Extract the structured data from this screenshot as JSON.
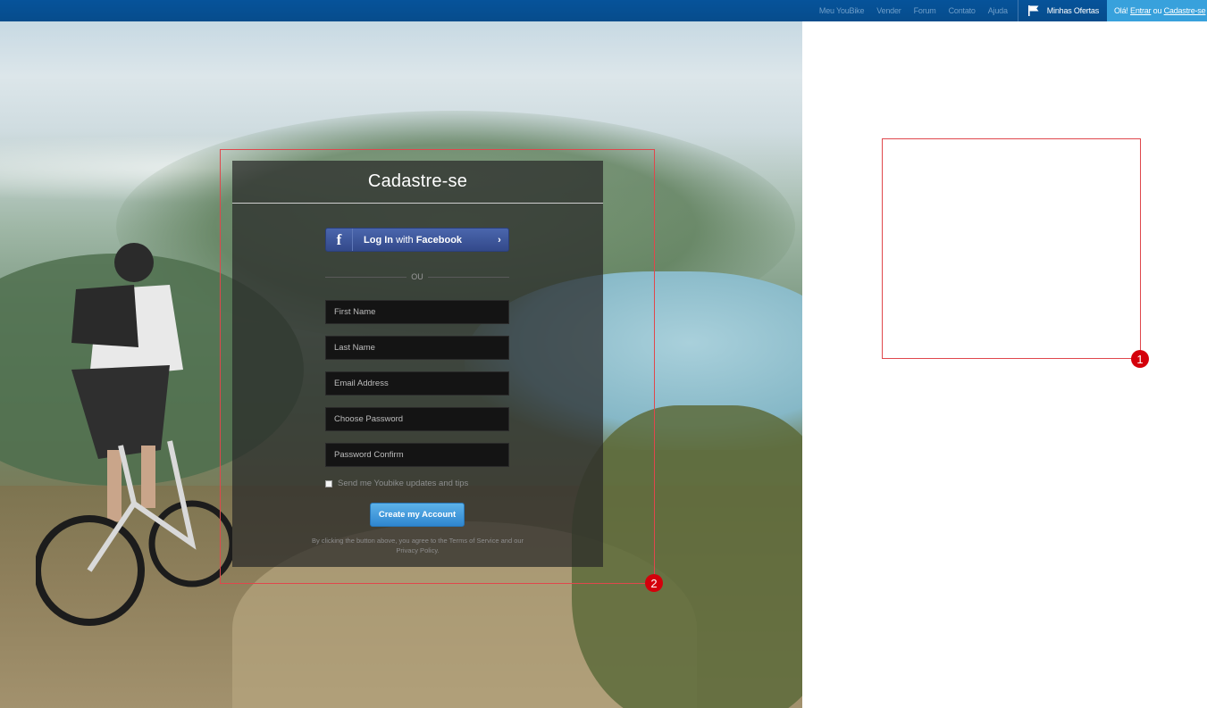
{
  "topbar": {
    "nav_items": [
      "Meu YouBike",
      "Vender",
      "Forum",
      "Contato",
      "Ajuda"
    ],
    "offers_label": "Minhas Ofertas",
    "greeting_prefix": "Olá!",
    "login_link": "Entrar",
    "greeting_or": "ou",
    "register_link": "Cadastre-se",
    "bar_color": "#06539a",
    "greeting_bg": "#38a1dc"
  },
  "signup": {
    "title": "Cadastre-se",
    "facebook_button": {
      "bold_prefix": "Log In",
      "middle": "with",
      "bold_suffix": "Facebook",
      "chevron": "›",
      "logo": "f"
    },
    "separator": "OU",
    "fields": {
      "first_name": "First Name",
      "last_name": "Last Name",
      "email": "Email Address",
      "password": "Choose Password",
      "password_confirm": "Password Confirm"
    },
    "newsletter_label": "Send me Youbike updates and tips",
    "submit_label": "Create my Account",
    "terms_text": "By clicking the button above, you agree to the Terms of Service and our Privacy Policy."
  },
  "annotations": [
    {
      "label": "1",
      "color": "#d4000b"
    },
    {
      "label": "2",
      "color": "#d4000b"
    }
  ],
  "icons": [
    "flag-icon",
    "facebook-icon",
    "chevron-right-icon",
    "checkbox-icon"
  ]
}
